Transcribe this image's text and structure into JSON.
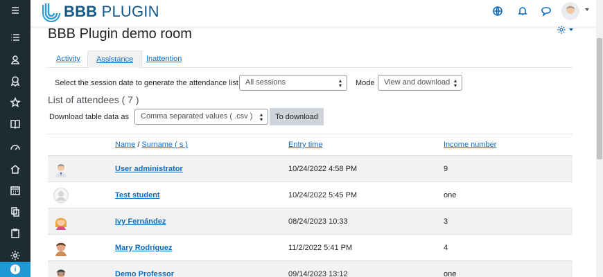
{
  "brand": {
    "name_bold": "BBB",
    "name_rest": " PLUGIN",
    "color": "#10588a"
  },
  "sidebar": {
    "items": [
      {
        "icon": "menu-icon"
      },
      {
        "icon": "list-icon"
      },
      {
        "icon": "contacts-icon"
      },
      {
        "icon": "badge-icon"
      },
      {
        "icon": "star-icon"
      },
      {
        "icon": "book-icon"
      },
      {
        "icon": "dashboard-icon"
      },
      {
        "icon": "home-icon"
      },
      {
        "icon": "calendar-icon"
      },
      {
        "icon": "files-icon"
      },
      {
        "icon": "clipboard-icon"
      },
      {
        "icon": "gear-icon"
      }
    ],
    "accessibility_icon": "accessibility-icon"
  },
  "header": {
    "icons": [
      "globe-icon",
      "bell-icon",
      "chat-icon",
      "user-avatar"
    ]
  },
  "page": {
    "title": "BBB Plugin demo room"
  },
  "tabs": [
    {
      "label": "Activity",
      "active": false
    },
    {
      "label": "Assistance",
      "active": true
    },
    {
      "label": "Inattention",
      "active": false
    }
  ],
  "filters": {
    "session_label": "Select the session date to generate the attendance list",
    "session_value": "All sessions",
    "mode_label": "Mode",
    "mode_value": "View and download"
  },
  "attendees": {
    "title": "List of attendees ( 7 )",
    "download_label": "Download table data as",
    "format_value": "Comma separated values ( .csv )",
    "download_button": "To download"
  },
  "table": {
    "headers": {
      "name": "Name",
      "separator": "/",
      "surname": "Surname ( s )",
      "entry": "Entry time",
      "income": "Income number"
    },
    "rows": [
      {
        "name": "User administrator",
        "entry": "10/24/2022 4:58 PM",
        "income": "9",
        "avatar": "admin"
      },
      {
        "name": "Test student",
        "entry": "10/24/2022 5:45 PM",
        "income": "one",
        "avatar": "blank"
      },
      {
        "name": "Ivy Fernández",
        "entry": "08/24/2023 10:33",
        "income": "3",
        "avatar": "ivy"
      },
      {
        "name": "Mary Rodríguez",
        "entry": "11/2/2022 5:41 PM",
        "income": "4",
        "avatar": "mary"
      },
      {
        "name": "Demo Professor",
        "entry": "09/14/2023 13:12",
        "income": "one",
        "avatar": "prof"
      }
    ]
  },
  "colors": {
    "link": "#0f6cbf",
    "sidebar": "#1e2b33",
    "accent": "#1f9ad6"
  }
}
